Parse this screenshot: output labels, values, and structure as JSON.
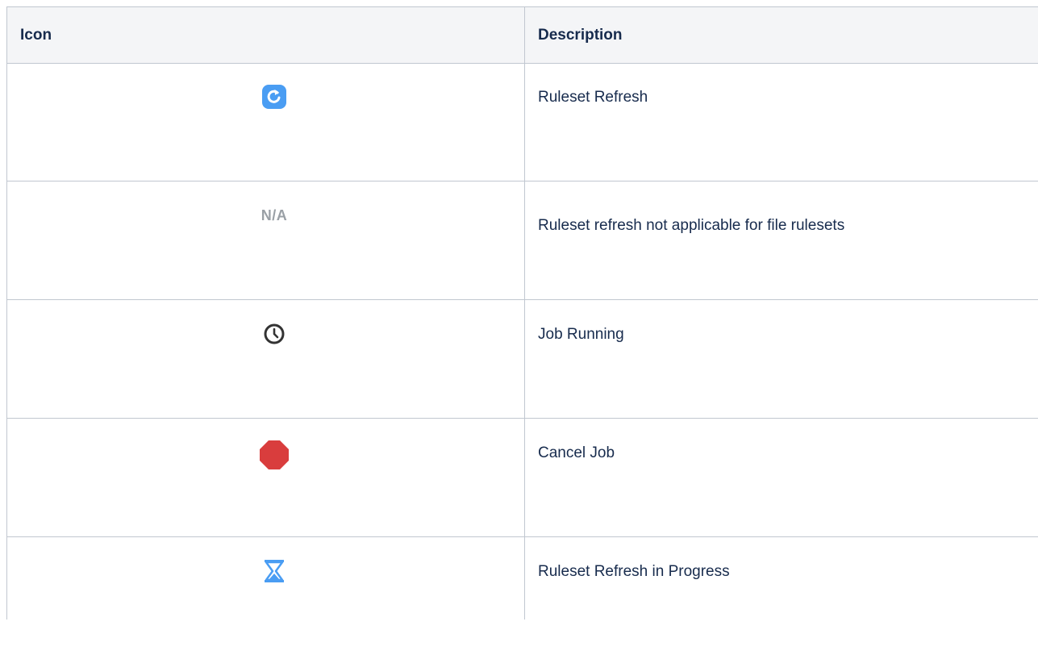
{
  "table": {
    "headers": {
      "icon": "Icon",
      "description": "Description"
    },
    "rows": [
      {
        "icon": "refresh-icon",
        "description": "Ruleset Refresh"
      },
      {
        "icon": "not-applicable-text",
        "icon_text": "N/A",
        "description": "Ruleset refresh not applicable for file rulesets"
      },
      {
        "icon": "clock-icon",
        "description": "Job Running"
      },
      {
        "icon": "stop-icon",
        "description": "Cancel Job"
      },
      {
        "icon": "hourglass-icon",
        "description": "Ruleset Refresh in Progress"
      }
    ]
  },
  "colors": {
    "refresh": "#4a9df3",
    "stop": "#d93d3d",
    "hourglass": "#4a9df3",
    "clock": "#333333",
    "na_text": "#9aa0a6",
    "border": "#c1c7d0",
    "header_bg": "#f4f5f7"
  }
}
